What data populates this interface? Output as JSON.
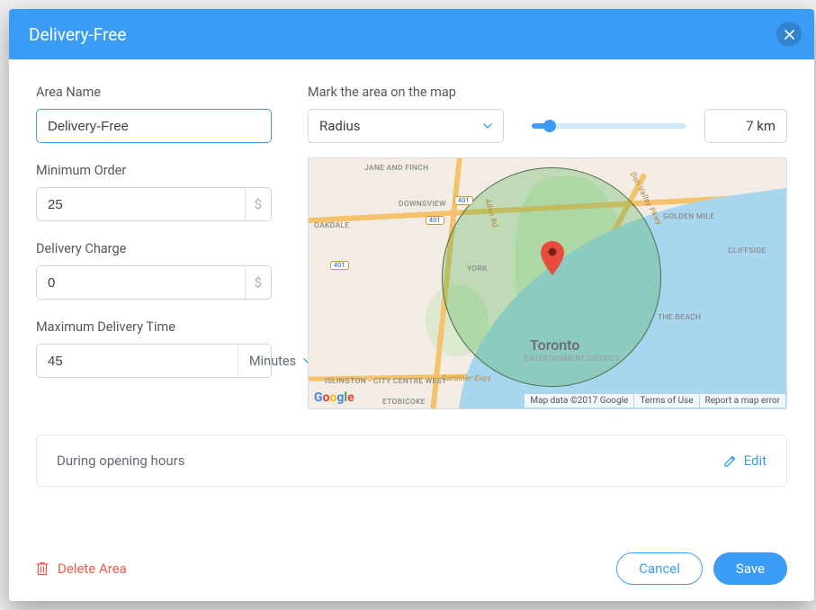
{
  "header": {
    "title": "Delivery-Free"
  },
  "left": {
    "areaName": {
      "label": "Area Name",
      "value": "Delivery-Free"
    },
    "minOrder": {
      "label": "Minimum Order",
      "value": "25",
      "currency": "$"
    },
    "deliveryCharge": {
      "label": "Delivery Charge",
      "value": "0",
      "currency": "$"
    },
    "maxTime": {
      "label": "Maximum Delivery Time",
      "value": "45",
      "unit": "Minutes"
    }
  },
  "right": {
    "label": "Mark the area on the map",
    "shape": "Radius",
    "distance": "7 km"
  },
  "map": {
    "cityLabel": "Toronto",
    "citySub": "ENTERTAINMENT DISTRICT",
    "labels": {
      "janeFinch": "JANE AND FINCH",
      "downsview": "DOWNSVIEW",
      "goldenMile": "GOLDEN MILE",
      "cliffside": "CLIFFSIDE",
      "theBeach": "THE BEACH",
      "york": "YORK",
      "oakdale": "OAKDALE",
      "islington": "ISLINGTON - CITY CENTRE WEST",
      "etobicoke": "ETOBICOKE",
      "hwy401a": "401",
      "hwy401b": "401",
      "hwy401c": "401",
      "allenRd": "Allen Rd",
      "donValley": "Don Valley Pkwy",
      "gardiner": "Gardiner Expy"
    },
    "attrib": {
      "data": "Map data ©2017 Google",
      "terms": "Terms of Use",
      "report": "Report a map error"
    }
  },
  "hours": {
    "text": "During opening hours",
    "edit": "Edit"
  },
  "footer": {
    "delete": "Delete Area",
    "cancel": "Cancel",
    "save": "Save"
  }
}
